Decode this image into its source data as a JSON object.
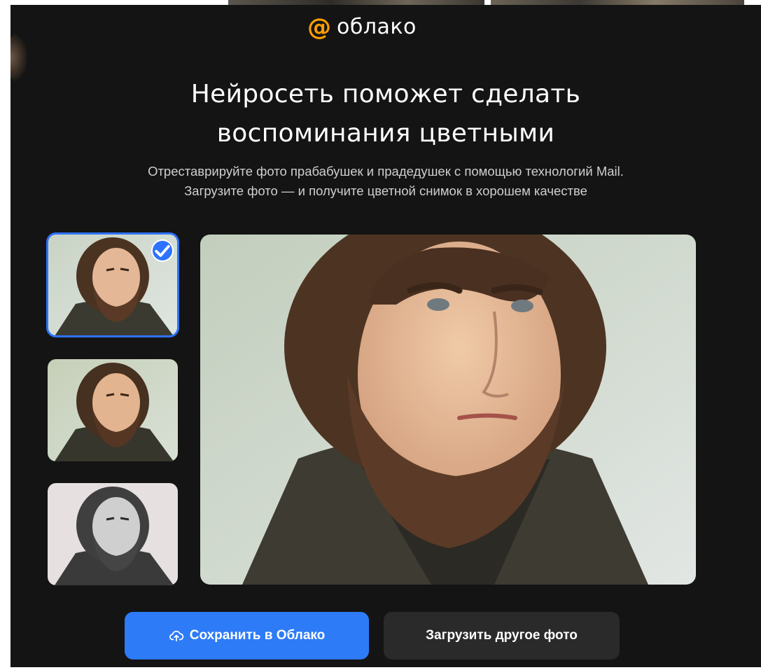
{
  "brand": {
    "logo_text": "облако",
    "logo_icon": "at-sign-icon",
    "accent_color": "#ff9e00"
  },
  "hero": {
    "title_line1": "Нейросеть поможет сделать",
    "title_line2": "воспоминания цветными",
    "subtitle_line1": "Отреставрируйте фото прабабушек и прадедушек с помощью технологий Mail.",
    "subtitle_line2": "Загрузите фото — и получите цветной снимок в хорошем качестве"
  },
  "variants": {
    "selected_index": 0,
    "items": [
      {
        "style": "colorized",
        "selected": true
      },
      {
        "style": "colorized-alt",
        "selected": false
      },
      {
        "style": "original-bw",
        "selected": false
      }
    ]
  },
  "actions": {
    "save_label": "Сохранить в Облако",
    "save_icon": "cloud-upload-icon",
    "upload_label": "Загрузить другое фото"
  },
  "colors": {
    "primary_button": "#2d7bf7",
    "secondary_button": "#2a2a2a",
    "selection": "#2d73ff",
    "background": "#141414"
  }
}
